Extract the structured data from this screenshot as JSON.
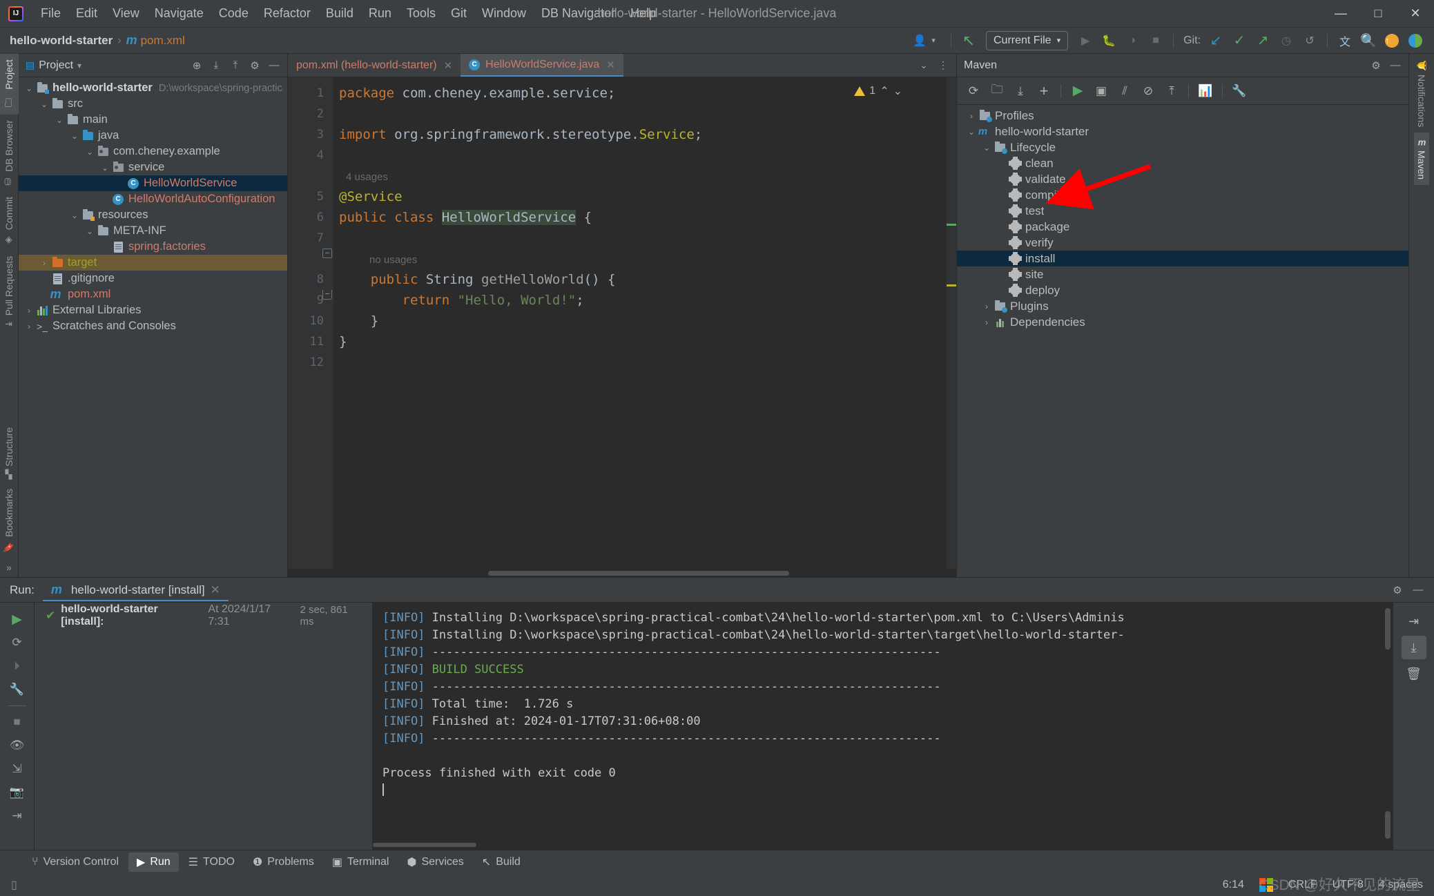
{
  "window": {
    "title": "hello-world-starter - HelloWorldService.java",
    "minimize": "—",
    "maximize": "□",
    "close": "✕"
  },
  "menu": {
    "items": [
      "File",
      "Edit",
      "View",
      "Navigate",
      "Code",
      "Refactor",
      "Build",
      "Run",
      "Tools",
      "Git",
      "Window",
      "DB Navigator",
      "Help"
    ]
  },
  "navbar": {
    "breadcrumb_project": "hello-world-starter",
    "breadcrumb_sep": "›",
    "breadcrumb_file": "pom.xml",
    "run_config": "Current File",
    "git_label": "Git:",
    "icons": [
      "user-avatar-icon",
      "chevron-down-icon",
      "build-arrow-icon",
      "run-icon",
      "debug-icon",
      "coverage-icon",
      "stop-icon",
      "git-update-icon",
      "git-commit-icon",
      "git-push-icon",
      "git-history-icon",
      "git-rollback-icon",
      "translate-icon",
      "search-icon",
      "update-icon",
      "plugin-icon"
    ]
  },
  "left_stripe": {
    "top": [
      {
        "label": "Project",
        "icon": "folder-icon",
        "active": true
      },
      {
        "label": "DB Browser",
        "icon": "database-icon",
        "active": false
      },
      {
        "label": "Commit",
        "icon": "commit-icon",
        "active": false
      },
      {
        "label": "Pull Requests",
        "icon": "pull-request-icon",
        "active": false
      }
    ],
    "bottom": [
      {
        "label": "Structure",
        "icon": "structure-icon"
      },
      {
        "label": "Bookmarks",
        "icon": "bookmark-icon"
      }
    ],
    "more": "»"
  },
  "right_stripe": {
    "items": [
      {
        "label": "Notifications",
        "icon": "bell-icon",
        "active": false
      },
      {
        "label": "Maven",
        "icon": "maven-m-icon",
        "active": true
      }
    ]
  },
  "project": {
    "title": "Project",
    "dropdown": "▾",
    "header_icons": [
      "locate-icon",
      "expand-all-icon",
      "collapse-all-icon",
      "gear-icon",
      "hide-icon"
    ],
    "tree": [
      {
        "label": "hello-world-starter",
        "path": "D:\\workspace\\spring-practical-c",
        "depth": 0,
        "chev": "v",
        "icon": "module-folder-icon",
        "style": "bold"
      },
      {
        "label": "src",
        "depth": 1,
        "chev": "v",
        "icon": "folder-icon",
        "style": ""
      },
      {
        "label": "main",
        "depth": 2,
        "chev": "v",
        "icon": "folder-icon",
        "style": ""
      },
      {
        "label": "java",
        "depth": 3,
        "chev": "v",
        "icon": "source-folder-icon",
        "style": ""
      },
      {
        "label": "com.cheney.example",
        "depth": 4,
        "chev": "v",
        "icon": "package-icon",
        "style": ""
      },
      {
        "label": "service",
        "depth": 5,
        "chev": "v",
        "icon": "package-icon",
        "style": ""
      },
      {
        "label": "HelloWorldService",
        "depth": 6,
        "chev": "",
        "icon": "class-icon",
        "style": "red",
        "selected": true
      },
      {
        "label": "HelloWorldAutoConfiguration",
        "depth": 5,
        "chev": "",
        "icon": "class-icon",
        "style": "red"
      },
      {
        "label": "resources",
        "depth": 3,
        "chev": "v",
        "icon": "resource-folder-icon",
        "style": ""
      },
      {
        "label": "META-INF",
        "depth": 4,
        "chev": "v",
        "icon": "folder-icon",
        "style": ""
      },
      {
        "label": "spring.factories",
        "depth": 5,
        "chev": "",
        "icon": "file-icon",
        "style": "red"
      },
      {
        "label": "target",
        "depth": 1,
        "chev": ">",
        "icon": "excluded-folder-icon",
        "style": "green",
        "dim_selected": true
      },
      {
        "label": ".gitignore",
        "depth": 1,
        "chev": "",
        "icon": "gitignore-icon",
        "style": ""
      },
      {
        "label": "pom.xml",
        "depth": 1,
        "chev": "",
        "icon": "maven-m-icon",
        "style": "red"
      },
      {
        "label": "External Libraries",
        "depth": 0,
        "chev": ">",
        "icon": "libraries-icon",
        "style": ""
      },
      {
        "label": "Scratches and Consoles",
        "depth": 0,
        "chev": ">",
        "icon": "scratches-icon",
        "style": ""
      }
    ]
  },
  "editor": {
    "tabs": [
      {
        "label": "pom.xml (hello-world-starter)",
        "icon": "",
        "active": false,
        "close": "✕"
      },
      {
        "label": "HelloWorldService.java",
        "icon": "class-icon",
        "active": true,
        "close": "✕"
      }
    ],
    "tab_right_icons": [
      "chevron-down-icon",
      "more-options-icon"
    ],
    "warning_count": "1",
    "warning_icon": "warning-triangle-icon",
    "nav_up": "⌃",
    "nav_down": "⌄",
    "line_numbers": [
      "1",
      "2",
      "3",
      "4",
      "5",
      "6",
      "7",
      "8",
      "9",
      "10",
      "11",
      "12"
    ],
    "code_lines": [
      {
        "n": 1,
        "segments": [
          {
            "t": "package",
            "c": "kw"
          },
          {
            "t": " com.cheney.example.service;",
            "c": ""
          }
        ]
      },
      {
        "n": 2,
        "segments": []
      },
      {
        "n": 3,
        "segments": [
          {
            "t": "import",
            "c": "kw"
          },
          {
            "t": " org.springframework.stereotype.",
            "c": ""
          },
          {
            "t": "Service",
            "c": "anno"
          },
          {
            "t": ";",
            "c": ""
          }
        ]
      },
      {
        "n": 4,
        "segments": []
      },
      {
        "n": 5,
        "segments": [
          {
            "t": "@Service",
            "c": "anno"
          }
        ],
        "hint": "4 usages"
      },
      {
        "n": 6,
        "segments": [
          {
            "t": "public class ",
            "c": "kw"
          },
          {
            "t": "HelloWorldService",
            "c": "hl"
          },
          {
            "t": " {",
            "c": ""
          }
        ]
      },
      {
        "n": 7,
        "segments": []
      },
      {
        "n": 8,
        "segments": [
          {
            "t": "    public String ",
            "c": "kw2"
          },
          {
            "t": "getHelloWorld",
            "c": "meth"
          },
          {
            "t": "() {",
            "c": ""
          }
        ],
        "hint": "no usages"
      },
      {
        "n": 9,
        "segments": [
          {
            "t": "        return ",
            "c": "kw"
          },
          {
            "t": "\"Hello, World!\"",
            "c": "str"
          },
          {
            "t": ";",
            "c": ""
          }
        ]
      },
      {
        "n": 10,
        "segments": [
          {
            "t": "    }",
            "c": ""
          }
        ]
      },
      {
        "n": 11,
        "segments": [
          {
            "t": "}",
            "c": ""
          }
        ]
      },
      {
        "n": 12,
        "segments": []
      }
    ]
  },
  "maven": {
    "title": "Maven",
    "header_icons": [
      "gear-icon",
      "hide-icon"
    ],
    "toolbar_icons": [
      "reload-icon",
      "add-module-icon",
      "download-sources-icon",
      "add-icon",
      "run-icon",
      "execute-goal-icon",
      "skip-tests-icon",
      "toggle-offline-icon",
      "collapse-all-icon",
      "show-diagram-icon",
      "settings-wrench-icon"
    ],
    "tree": [
      {
        "label": "Profiles",
        "depth": 0,
        "chev": ">",
        "icon": "profiles-icon"
      },
      {
        "label": "hello-world-starter",
        "depth": 0,
        "chev": "v",
        "icon": "maven-project-icon"
      },
      {
        "label": "Lifecycle",
        "depth": 1,
        "chev": "v",
        "icon": "lifecycle-folder-icon"
      },
      {
        "label": "clean",
        "depth": 2,
        "chev": "",
        "icon": "goal-gear-icon"
      },
      {
        "label": "validate",
        "depth": 2,
        "chev": "",
        "icon": "goal-gear-icon"
      },
      {
        "label": "compile",
        "depth": 2,
        "chev": "",
        "icon": "goal-gear-icon"
      },
      {
        "label": "test",
        "depth": 2,
        "chev": "",
        "icon": "goal-gear-icon"
      },
      {
        "label": "package",
        "depth": 2,
        "chev": "",
        "icon": "goal-gear-icon"
      },
      {
        "label": "verify",
        "depth": 2,
        "chev": "",
        "icon": "goal-gear-icon"
      },
      {
        "label": "install",
        "depth": 2,
        "chev": "",
        "icon": "goal-gear-icon",
        "selected": true
      },
      {
        "label": "site",
        "depth": 2,
        "chev": "",
        "icon": "goal-gear-icon"
      },
      {
        "label": "deploy",
        "depth": 2,
        "chev": "",
        "icon": "goal-gear-icon"
      },
      {
        "label": "Plugins",
        "depth": 1,
        "chev": ">",
        "icon": "plugins-folder-icon"
      },
      {
        "label": "Dependencies",
        "depth": 1,
        "chev": ">",
        "icon": "dependencies-icon"
      }
    ],
    "annotation_arrow_color": "#ff0000"
  },
  "run": {
    "label": "Run:",
    "tab": "hello-world-starter [install]",
    "tab_close": "✕",
    "head_icons": [
      "gear-icon",
      "hide-icon"
    ],
    "side_icons": [
      "rerun-icon",
      "rerun-failed-icon",
      "skip-to-end-icon",
      "settings-wrench-icon",
      "stop-icon",
      "eye-filter-icon",
      "expand-collapse-icon",
      "screenshot-icon",
      "export-icon"
    ],
    "tree_item": {
      "check": "✔",
      "name": "hello-world-starter [install]:",
      "timestamp": "At 2024/1/17 7:31",
      "duration": "2 sec, 861 ms"
    },
    "console_right_icons": [
      "soft-wrap-icon",
      "scroll-to-end-icon",
      "trash-icon"
    ],
    "console_lines": [
      {
        "tag": "[INFO]",
        "text": " Installing D:\\workspace\\spring-practical-combat\\24\\hello-world-starter\\pom.xml to C:\\Users\\Adminis",
        "style": ""
      },
      {
        "tag": "[INFO]",
        "text": " Installing D:\\workspace\\spring-practical-combat\\24\\hello-world-starter\\target\\hello-world-starter-",
        "style": ""
      },
      {
        "tag": "[INFO]",
        "text": " ------------------------------------------------------------------------",
        "style": ""
      },
      {
        "tag": "[INFO]",
        "text": " BUILD SUCCESS",
        "style": "succ"
      },
      {
        "tag": "[INFO]",
        "text": " ------------------------------------------------------------------------",
        "style": ""
      },
      {
        "tag": "[INFO]",
        "text": " Total time:  1.726 s",
        "style": ""
      },
      {
        "tag": "[INFO]",
        "text": " Finished at: 2024-01-17T07:31:06+08:00",
        "style": ""
      },
      {
        "tag": "[INFO]",
        "text": " ------------------------------------------------------------------------",
        "style": ""
      },
      {
        "tag": "",
        "text": "",
        "style": ""
      },
      {
        "tag": "",
        "text": "Process finished with exit code 0",
        "style": ""
      }
    ]
  },
  "toolwindows": {
    "items": [
      {
        "label": "Version Control",
        "icon": "branch-icon",
        "active": false
      },
      {
        "label": "Run",
        "icon": "run-triangle-icon",
        "active": true
      },
      {
        "label": "TODO",
        "icon": "todo-list-icon",
        "active": false
      },
      {
        "label": "Problems",
        "icon": "problems-icon",
        "active": false
      },
      {
        "label": "Terminal",
        "icon": "terminal-icon",
        "active": false
      },
      {
        "label": "Services",
        "icon": "services-icon",
        "active": false
      },
      {
        "label": "Build",
        "icon": "build-hammer-icon",
        "active": false
      }
    ]
  },
  "statusbar": {
    "caret_position": "6:14",
    "line_separator": "CRLF",
    "encoding": "UTF-8",
    "indent": "4 spaces",
    "os_icon": "windows-logo-icon",
    "watermark": "CSDN @好久不见的流星"
  }
}
